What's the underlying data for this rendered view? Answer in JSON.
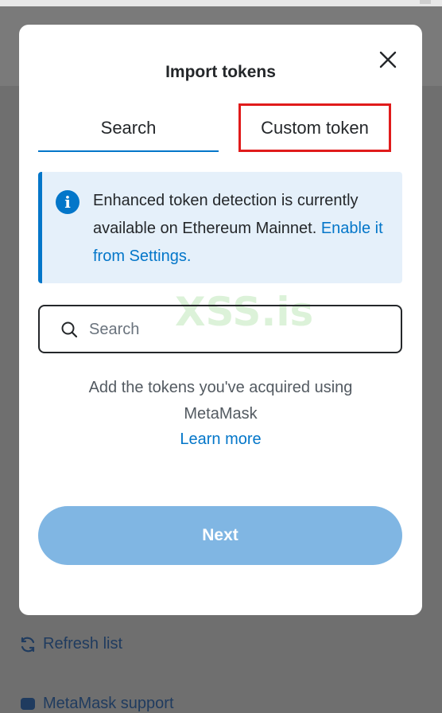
{
  "modal": {
    "title": "Import tokens",
    "tabs": [
      {
        "label": "Search",
        "active": true
      },
      {
        "label": "Custom token",
        "active": false,
        "highlighted": true
      }
    ],
    "notice": {
      "text": "Enhanced token detection is currently available on Ethereum Mainnet. ",
      "link": "Enable it from Settings."
    },
    "search": {
      "placeholder": "Search",
      "value": ""
    },
    "helper": {
      "line1": "Add the tokens you've acquired using",
      "line2": "MetaMask"
    },
    "learn_more": "Learn more",
    "next_label": "Next"
  },
  "background": {
    "refresh_label": "Refresh list",
    "support_label": "MetaMask support"
  },
  "watermark": "XSS.is",
  "colors": {
    "accent": "#0376c9",
    "next_disabled": "#80b6e3",
    "highlight_box": "#e01b1b",
    "notice_bg": "#e5f0fa"
  },
  "icons": [
    "close-icon",
    "info-icon",
    "search-icon",
    "refresh-icon",
    "support-icon"
  ]
}
